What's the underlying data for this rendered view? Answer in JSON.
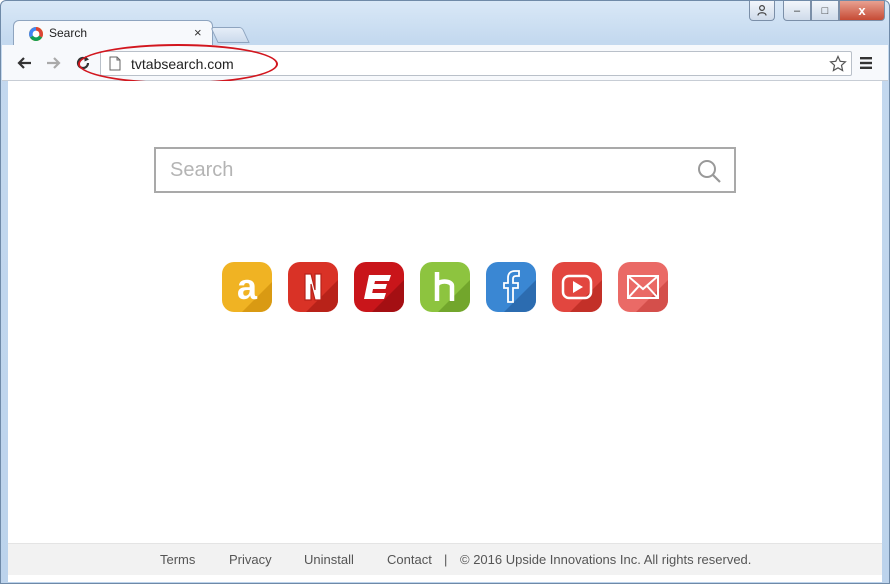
{
  "tab": {
    "title": "Search",
    "close_glyph": "×",
    "favicon": "chrome-search-favicon"
  },
  "window_controls": {
    "minimize": "–",
    "maximize": "□",
    "close": "x"
  },
  "omnibox": {
    "url": "tvtabsearch.com"
  },
  "search": {
    "placeholder": "Search"
  },
  "tiles": [
    {
      "name": "amazon",
      "icon": "amazon-icon",
      "color": "#f0b323"
    },
    {
      "name": "netflix",
      "icon": "netflix-icon",
      "color": "#d93226"
    },
    {
      "name": "espn",
      "icon": "espn-icon",
      "color": "#d11c1f"
    },
    {
      "name": "hulu",
      "icon": "hulu-icon",
      "color": "#8dc43f"
    },
    {
      "name": "facebook",
      "icon": "facebook-icon",
      "color": "#3a87d3"
    },
    {
      "name": "youtube",
      "icon": "youtube-icon",
      "color": "#e2463f"
    },
    {
      "name": "mail",
      "icon": "mail-icon",
      "color": "#ea6a66"
    }
  ],
  "footer": {
    "terms": "Terms",
    "privacy": "Privacy",
    "uninstall": "Uninstall",
    "contact": "Contact",
    "separator": "|",
    "copyright": "© 2016 Upside Innovations Inc. All rights reserved."
  },
  "colors": {
    "url_highlight": "#d2161e",
    "window_close": "#c64b35",
    "footer_bg": "#f2f2f2"
  }
}
